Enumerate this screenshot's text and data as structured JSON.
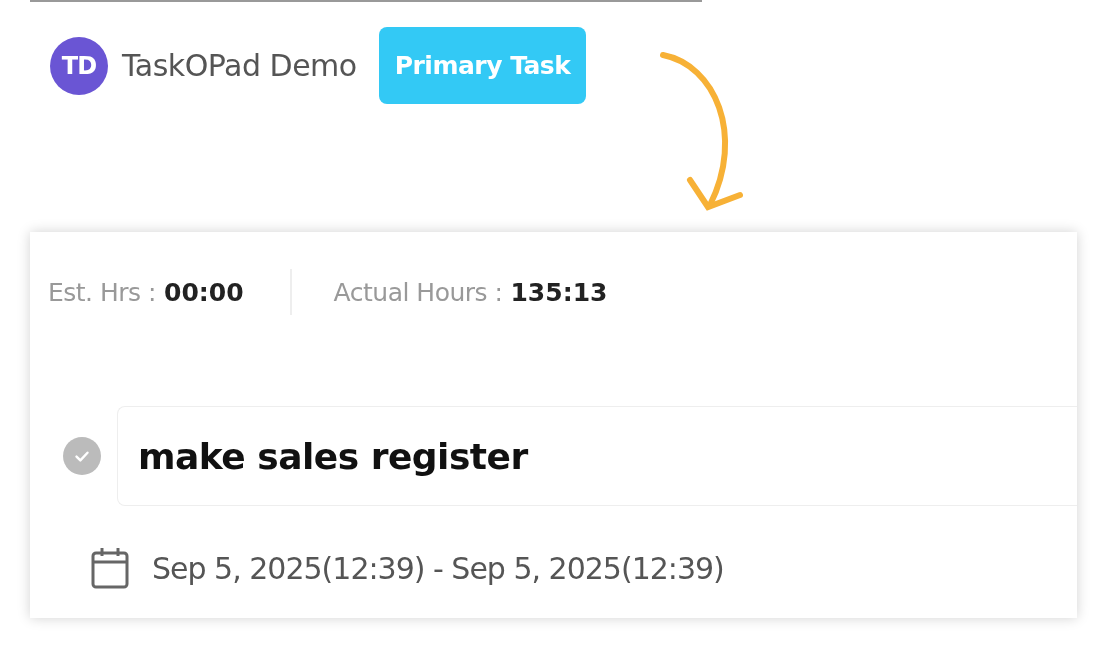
{
  "header": {
    "avatar": "TD",
    "workspace": "TaskOPad Demo",
    "task_type_button": "Primary Task"
  },
  "hours": [
    {
      "label": "Est. Hrs :",
      "value": "00:00"
    },
    {
      "label": "Actual Hours :",
      "value": "135:13"
    }
  ],
  "task": {
    "title": "make sales register",
    "dates": "Sep 5, 2025(12:39) - Sep 5, 2025(12:39)"
  }
}
